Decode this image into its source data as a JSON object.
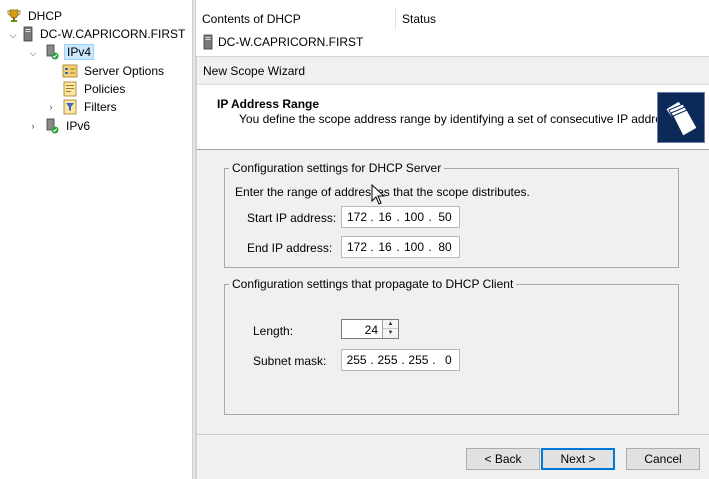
{
  "tree": {
    "root": "DHCP",
    "server": "DC-W.CAPRICORN.FIRST",
    "ipv4": "IPv4",
    "server_options": "Server Options",
    "policies": "Policies",
    "filters": "Filters",
    "ipv6": "IPv6"
  },
  "list": {
    "columns": [
      "Contents of DHCP",
      "Status"
    ],
    "rows": [
      {
        "name": "DC-W.CAPRICORN.FIRST",
        "status": ""
      }
    ]
  },
  "wizard": {
    "title": "New Scope Wizard",
    "header_title": "IP Address Range",
    "header_desc": "You define the scope address range by identifying a set of consecutive IP addresses.",
    "server_group": {
      "legend": "Configuration settings for DHCP Server",
      "instruction": "Enter the range of addresses that the scope distributes.",
      "start_label": "Start IP address:",
      "start_ip": [
        "172",
        "16",
        "100",
        "50"
      ],
      "end_label": "End IP address:",
      "end_ip": [
        "172",
        "16",
        "100",
        "80"
      ]
    },
    "client_group": {
      "legend": "Configuration settings that propagate to DHCP Client",
      "length_label": "Length:",
      "length_value": "24",
      "mask_label": "Subnet mask:",
      "mask": [
        "255",
        "255",
        "255",
        "0"
      ]
    },
    "buttons": {
      "back": "< Back",
      "next": "Next >",
      "cancel": "Cancel"
    }
  }
}
